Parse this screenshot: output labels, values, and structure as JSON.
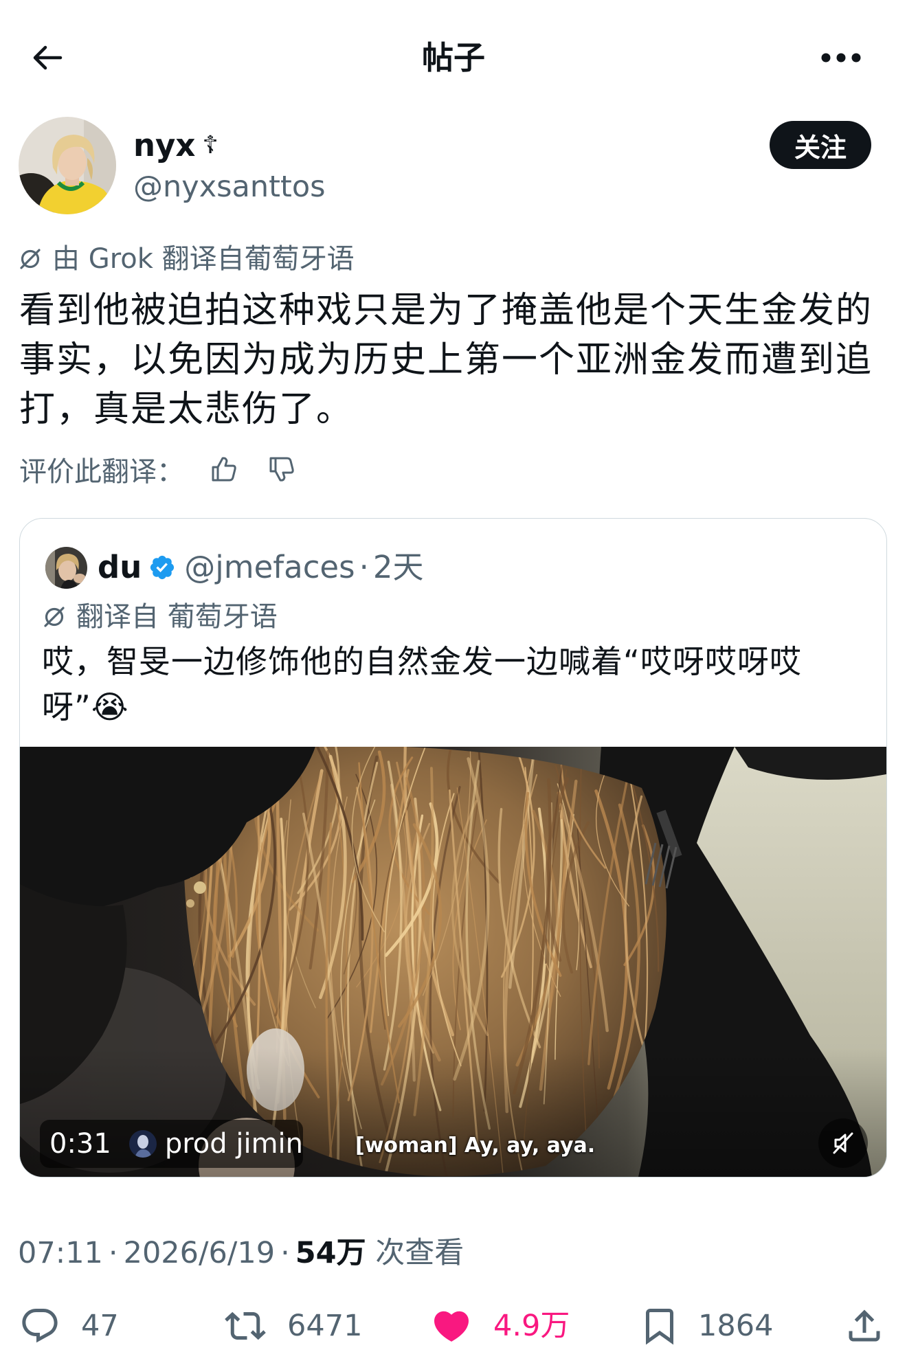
{
  "header": {
    "title": "帖子",
    "back_icon": "arrow-left-icon",
    "more_icon": "more-horizontal-icon"
  },
  "post": {
    "author": {
      "name": "nyx",
      "name_symbol": "☦",
      "handle": "@nyxsanttos"
    },
    "follow_label": "关注",
    "translation_note": {
      "icon": "grok-icon",
      "text": "由 Grok 翻译自葡萄牙语"
    },
    "text": "看到他被迫拍这种戏只是为了掩盖他是个天生金发的事实，以免因为成为历史上第一个亚洲金发而遭到追打，真是太悲伤了。",
    "rate_translation": {
      "label": "评价此翻译：",
      "icons": [
        "thumbs-up-icon",
        "thumbs-down-icon"
      ]
    }
  },
  "quoted": {
    "author_name": "du",
    "verified": true,
    "handle": "@jmefaces",
    "separator": "·",
    "age": "2天",
    "translation_note": "翻译自 葡萄牙语",
    "text": "哎，智旻一边修饰他的自然金发一边喊着“哎呀哎呀哎呀”😭",
    "video": {
      "duration": "0:31",
      "attribution": "prod jimin",
      "subtitle": "[woman] Ay, ay, aya.",
      "muted": true,
      "mute_icon": "volume-muted-icon"
    }
  },
  "meta": {
    "time": "07:11",
    "separator": "·",
    "date": "2026/6/19",
    "views": "54万",
    "views_label": "次查看"
  },
  "actions": {
    "replies": "47",
    "reposts": "6471",
    "likes": "4.9万",
    "liked": true,
    "bookmarks": "1864",
    "icons": [
      "reply-icon",
      "repost-icon",
      "heart-icon",
      "bookmark-icon",
      "share-icon"
    ]
  },
  "colors": {
    "text": "#0f1419",
    "secondary": "#536471",
    "like": "#f91880",
    "verified": "#1d9bf0",
    "border": "#cfd9de"
  }
}
